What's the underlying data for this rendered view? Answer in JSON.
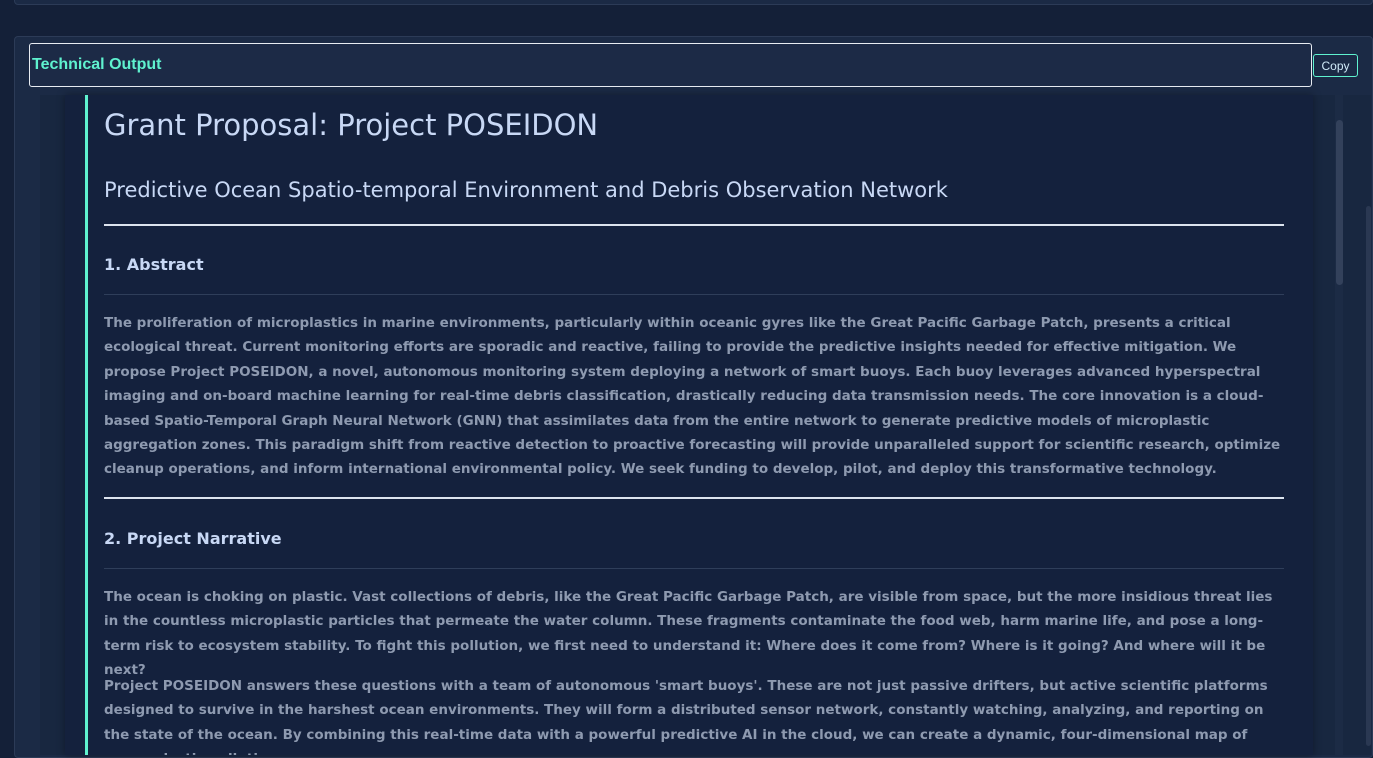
{
  "panel": {
    "title": "Technical Output",
    "copy_label": "Copy"
  },
  "document": {
    "title": "Grant Proposal: Project POSEIDON",
    "subtitle": "Predictive Ocean Spatio-temporal Environment and Debris Observation Network",
    "sections": [
      {
        "heading": "1. Abstract",
        "paragraphs": [
          "The proliferation of microplastics in marine environments, particularly within oceanic gyres like the Great Pacific Garbage Patch, presents a critical ecological threat. Current monitoring efforts are sporadic and reactive, failing to provide the predictive insights needed for effective mitigation. We propose Project POSEIDON, a novel, autonomous monitoring system deploying a network of smart buoys. Each buoy leverages advanced hyperspectral imaging and on-board machine learning for real-time debris classification, drastically reducing data transmission needs. The core innovation is a cloud-based Spatio-Temporal Graph Neural Network (GNN) that assimilates data from the entire network to generate predictive models of microplastic aggregation zones. This paradigm shift from reactive detection to proactive forecasting will provide unparalleled support for scientific research, optimize cleanup operations, and inform international environmental policy. We seek funding to develop, pilot, and deploy this transformative technology."
        ]
      },
      {
        "heading": "2. Project Narrative",
        "paragraphs": [
          "The ocean is choking on plastic. Vast collections of debris, like the Great Pacific Garbage Patch, are visible from space, but the more insidious threat lies in the countless microplastic particles that permeate the water column. These fragments contaminate the food web, harm marine life, and pose a long-term risk to ecosystem stability. To fight this pollution, we first need to understand it: Where does it come from? Where is it going? And where will it be next?",
          "Project POSEIDON answers these questions with a team of autonomous 'smart buoys'. These are not just passive drifters, but active scientific platforms designed to survive in the harshest ocean environments. They will form a distributed sensor network, constantly watching, analyzing, and reporting on the state of the ocean. By combining this real-time data with a powerful predictive AI in the cloud, we can create a dynamic, four-dimensional map of ocean plastic pollution."
        ]
      }
    ]
  },
  "colors": {
    "accent": "#5ff2cf",
    "background": "#142038",
    "heading_text": "#c8d8f5",
    "body_text": "#8e9ab0"
  }
}
